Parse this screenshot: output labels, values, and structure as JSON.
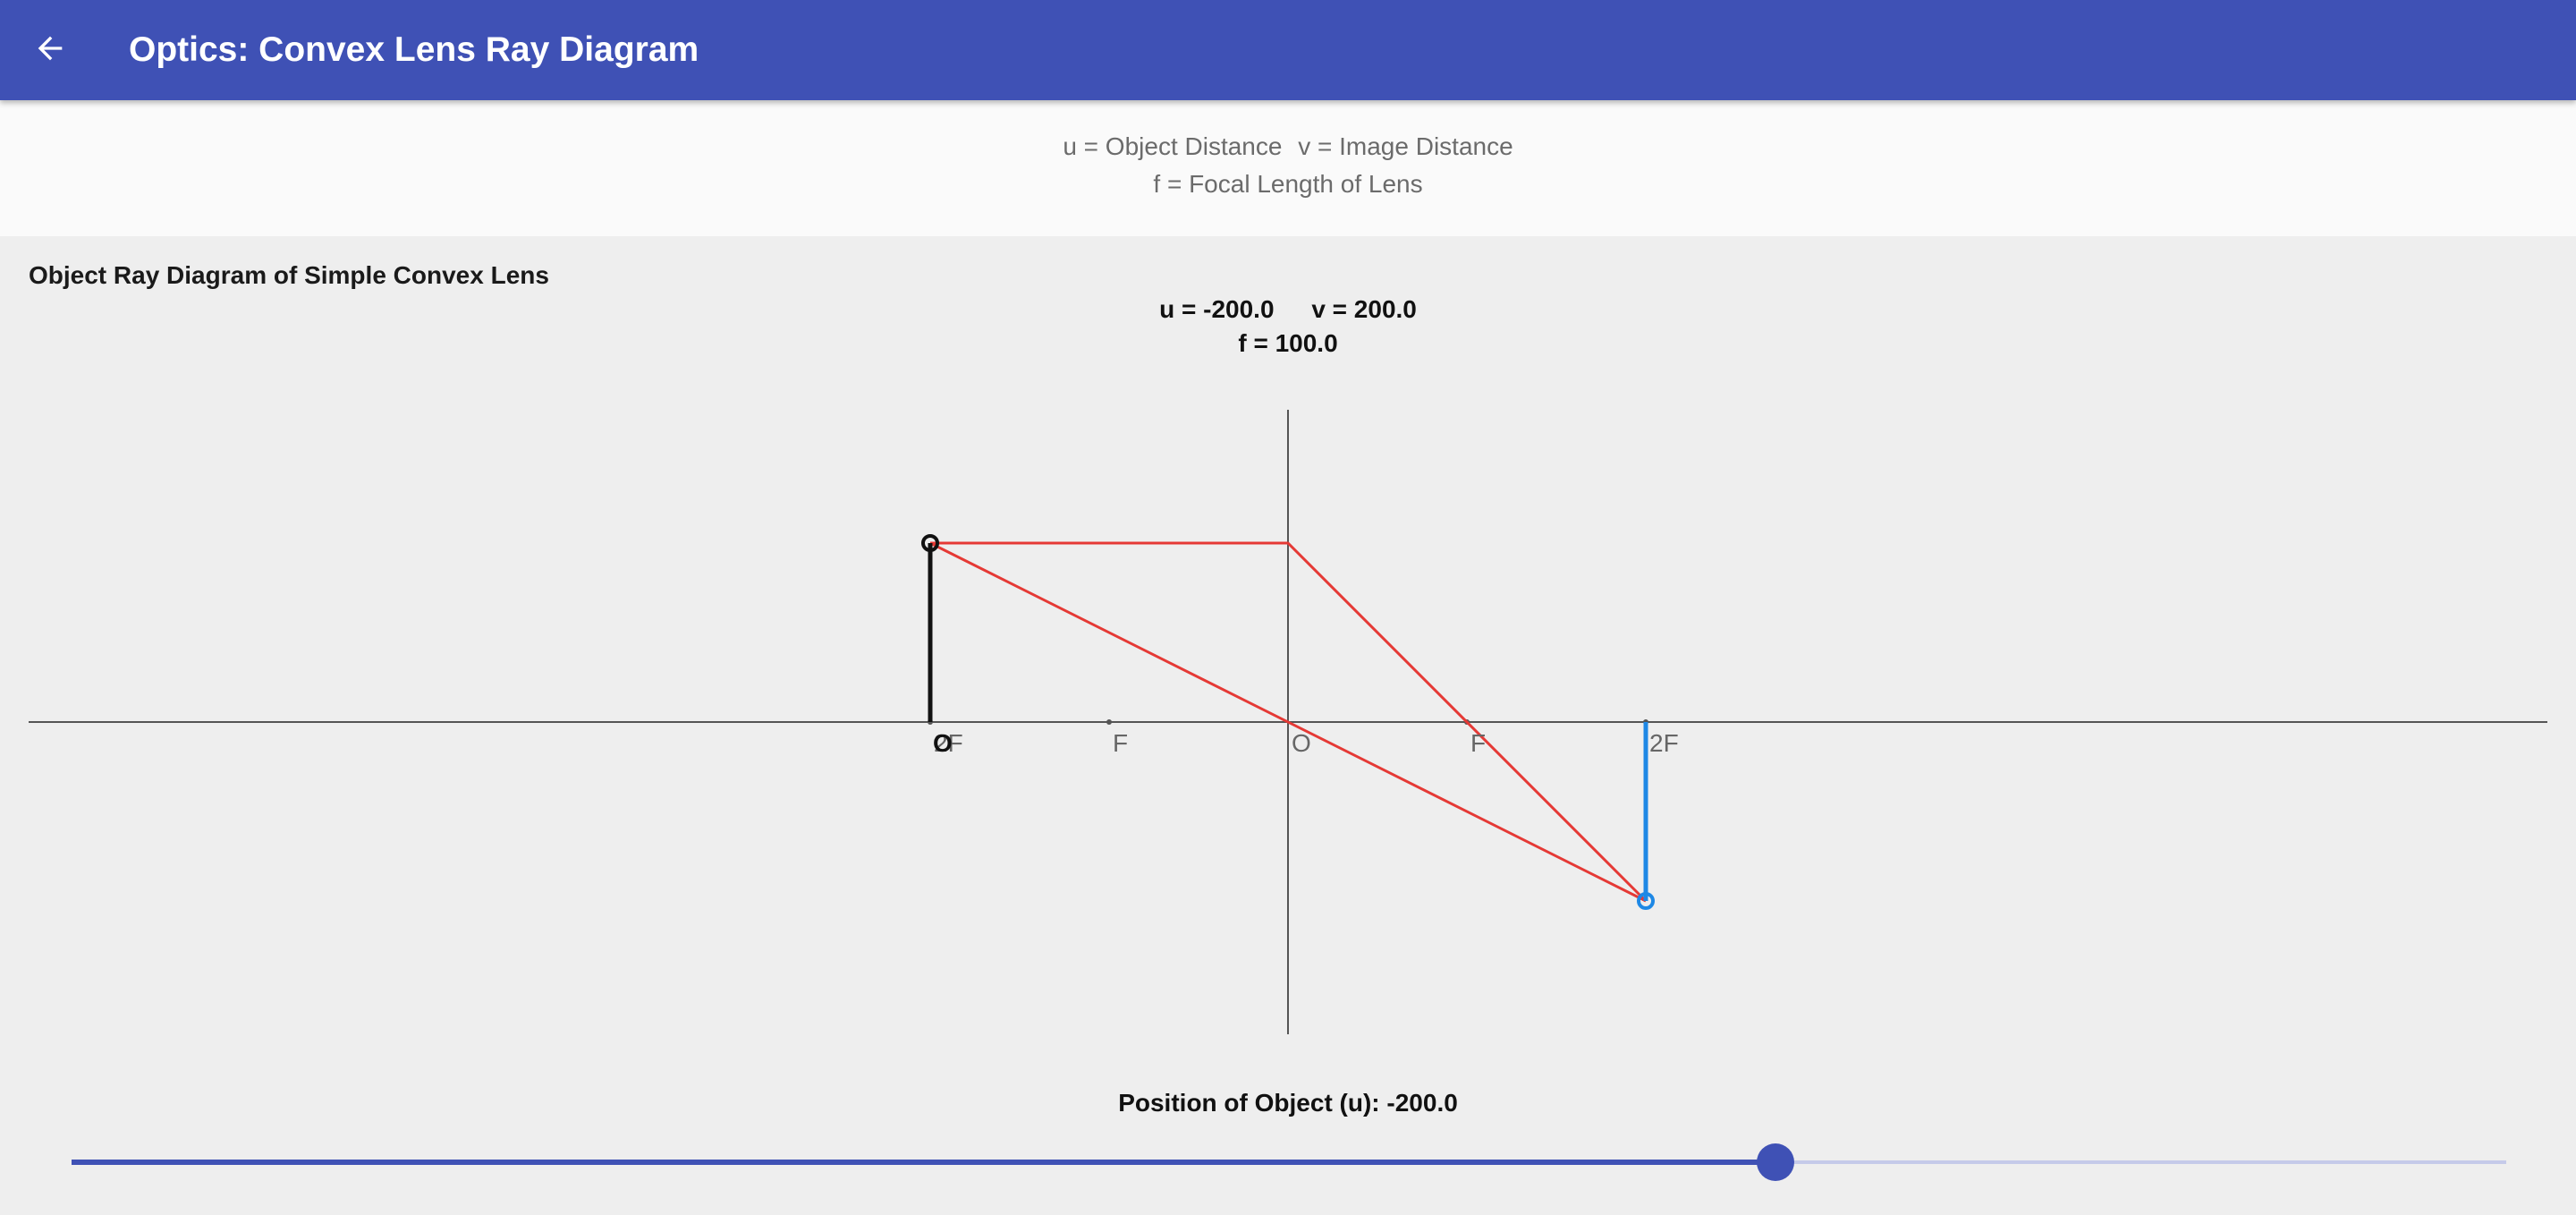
{
  "app": {
    "title": "Optics: Convex Lens Ray Diagram",
    "back_icon": "arrow-left-icon",
    "accent_color": "#3f51b5"
  },
  "legend": {
    "u_def": "u = Object Distance",
    "v_def": "v = Image Distance",
    "f_def": "f = Focal Length of Lens"
  },
  "diagram": {
    "section_title": "Object Ray Diagram of Simple Convex Lens",
    "u_text": "u = -200.0",
    "v_text": "v = 200.0",
    "f_text": "f = 100.0",
    "u": -200.0,
    "v": 200.0,
    "f": 100.0,
    "object_height": 100,
    "axis_labels": {
      "object": "O",
      "two_f_left": "2F",
      "f_left": "F",
      "optical_center": "O",
      "f_right": "F",
      "two_f_right": "2F"
    },
    "colors": {
      "ray": "#e53935",
      "object": "#111111",
      "image": "#1e88e5",
      "axis": "#555555",
      "label": "#666666"
    }
  },
  "slider": {
    "label": "Position of Object (u): -200.0",
    "value": -200.0,
    "min": -550,
    "max": -50
  }
}
